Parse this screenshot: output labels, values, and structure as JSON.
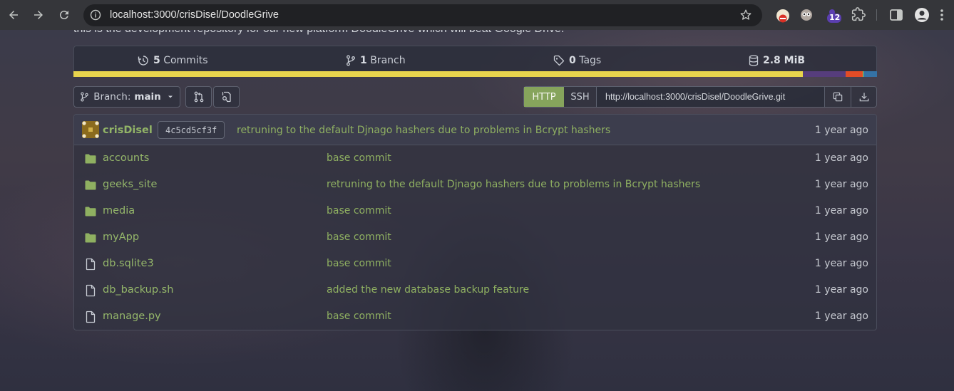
{
  "browser": {
    "url": "localhost:3000/crisDisel/DoodleGrive",
    "extension_badge": "12"
  },
  "repo": {
    "description": "this is the development repository for our new platform DoodleGrive which will beat Google Drive.",
    "stats": {
      "commits_count": "5",
      "commits_label": "Commits",
      "branches_count": "1",
      "branches_label": "Branch",
      "tags_count": "0",
      "tags_label": "Tags",
      "size": "2.8 MiB"
    },
    "languages": [
      {
        "color": "#e8d44d",
        "share": 0.908
      },
      {
        "color": "#563d7c",
        "share": 0.053
      },
      {
        "color": "#e34c26",
        "share": 0.021
      },
      {
        "color": "#89e051",
        "share": 0.001
      },
      {
        "color": "#3572a5",
        "share": 0.017
      }
    ]
  },
  "toolbar": {
    "branch_label": "Branch:",
    "branch_name": "main",
    "clone_http": "HTTP",
    "clone_ssh": "SSH",
    "clone_url": "http://localhost:3000/crisDisel/DoodleGrive.git"
  },
  "latest_commit": {
    "author": "crisDisel",
    "sha": "4c5cd5cf3f",
    "message": "retruning to the default Djnago hashers due to problems in Bcrypt hashers",
    "time": "1 year ago"
  },
  "files": [
    {
      "type": "folder",
      "name": "accounts",
      "message": "base commit",
      "time": "1 year ago"
    },
    {
      "type": "folder",
      "name": "geeks_site",
      "message": "retruning to the default Djnago hashers due to problems in Bcrypt hashers",
      "time": "1 year ago"
    },
    {
      "type": "folder",
      "name": "media",
      "message": "base commit",
      "time": "1 year ago"
    },
    {
      "type": "folder",
      "name": "myApp",
      "message": "base commit",
      "time": "1 year ago"
    },
    {
      "type": "file",
      "name": "db.sqlite3",
      "message": "base commit",
      "time": "1 year ago"
    },
    {
      "type": "file",
      "name": "db_backup.sh",
      "message": "added the new database backup feature",
      "time": "1 year ago"
    },
    {
      "type": "file",
      "name": "manage.py",
      "message": "base commit",
      "time": "1 year ago"
    }
  ],
  "colors": {
    "accent_green": "#86a45c",
    "link_green": "#95b76a"
  }
}
